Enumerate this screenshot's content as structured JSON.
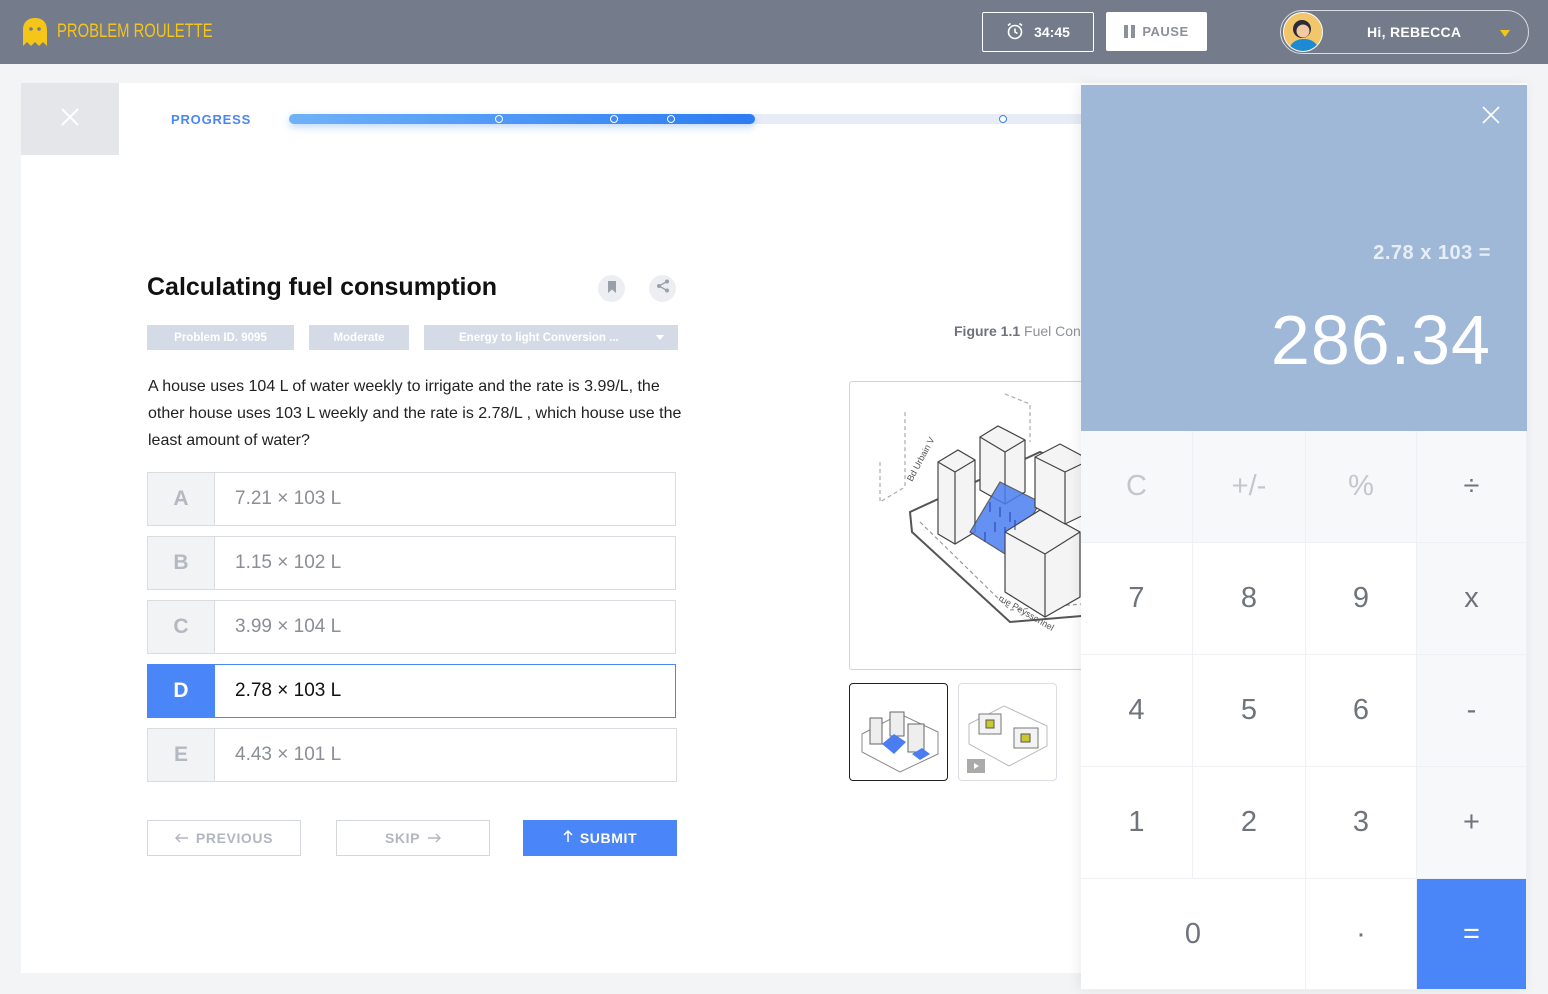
{
  "header": {
    "logo_text": "Problem Roulette",
    "timer": "34:45",
    "pause_label": "PAUSE",
    "greeting": "Hi, REBECCA"
  },
  "progress": {
    "label": "PROGRESS",
    "fraction_complete": 0.44
  },
  "question": {
    "title": "Calculating fuel consumption",
    "tags": {
      "problem_id": "Problem ID. 9095",
      "difficulty": "Moderate",
      "topic": "Energy to light Conversion ..."
    },
    "text": "A house uses 104 L of water weekly to irrigate and the rate is 3.99/L, the other house uses 103 L weekly and the rate is 2.78/L , which house use the least amount of water?",
    "choices": [
      {
        "letter": "A",
        "answer": "7.21 × 103 L",
        "selected": false
      },
      {
        "letter": "B",
        "answer": "1.15 × 102 L",
        "selected": false
      },
      {
        "letter": "C",
        "answer": "3.99 × 104 L",
        "selected": false
      },
      {
        "letter": "D",
        "answer": "2.78 × 103 L",
        "selected": true
      },
      {
        "letter": "E",
        "answer": "4.43 × 101 L",
        "selected": false
      }
    ]
  },
  "nav": {
    "previous": "PREVIOUS",
    "skip": "SKIP",
    "submit": "SUBMIT"
  },
  "figure": {
    "caption_label": "Figure 1.1",
    "caption_text": "Fuel Con",
    "street_1": "Bd Urbain V",
    "street_2": "rue Peyssonnel"
  },
  "calculator": {
    "expression": "2.78 x 103 =",
    "result": "286.34",
    "keys": {
      "clear": "C",
      "sign": "+/-",
      "percent": "%",
      "divide": "÷",
      "seven": "7",
      "eight": "8",
      "nine": "9",
      "multiply": "x",
      "four": "4",
      "five": "5",
      "six": "6",
      "minus": "-",
      "one": "1",
      "two": "2",
      "three": "3",
      "plus": "+",
      "zero": "0",
      "decimal": "·",
      "equals": "="
    }
  },
  "colors": {
    "accent": "#4a86f7",
    "topbar": "#747b8a",
    "logo": "#f5c518",
    "calc_display": "#9fb8d8"
  }
}
